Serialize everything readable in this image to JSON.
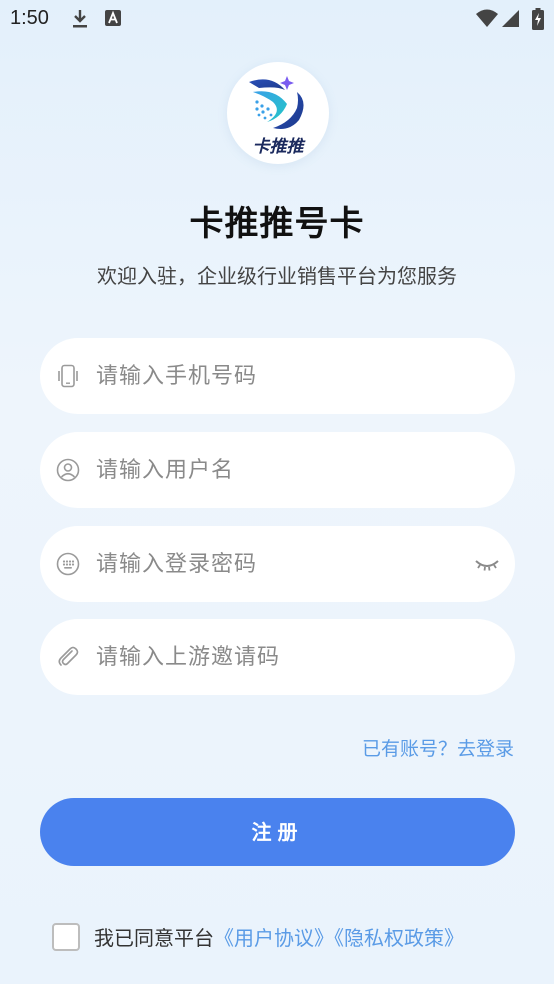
{
  "status_bar": {
    "time": "1:50"
  },
  "app": {
    "logo_text": "卡推推",
    "title": "卡推推号卡",
    "subtitle": "欢迎入驻，企业级行业销售平台为您服务"
  },
  "form": {
    "phone_placeholder": "请输入手机号码",
    "username_placeholder": "请输入用户名",
    "password_placeholder": "请输入登录密码",
    "invite_placeholder": "请输入上游邀请码"
  },
  "login_link": "已有账号？去登录",
  "register_button": "注册",
  "agreement": {
    "prefix": "我已同意平台",
    "user_agreement": "《用户协议》",
    "privacy_policy": "《隐私权政策》"
  },
  "colors": {
    "primary": "#4a82ee",
    "link": "#5a9be6",
    "background": "#e8f2fc"
  }
}
